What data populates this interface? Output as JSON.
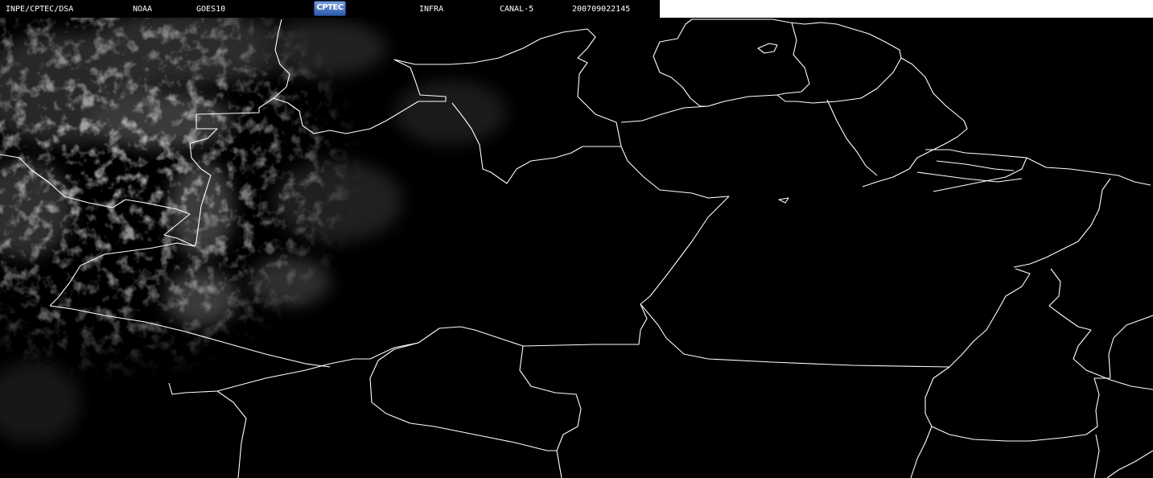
{
  "header": {
    "source": "INPE/CPTEC/DSA",
    "agency": "NOAA",
    "satellite": "GOES10",
    "logo_text": "CPTEC",
    "band": "INFRA",
    "channel": "CANAL-5",
    "timestamp": "200709022145"
  },
  "colors": {
    "background": "#000000",
    "borders": "#ffffff",
    "clouds": "#9a9a9a",
    "logo": "#3a66b8"
  }
}
